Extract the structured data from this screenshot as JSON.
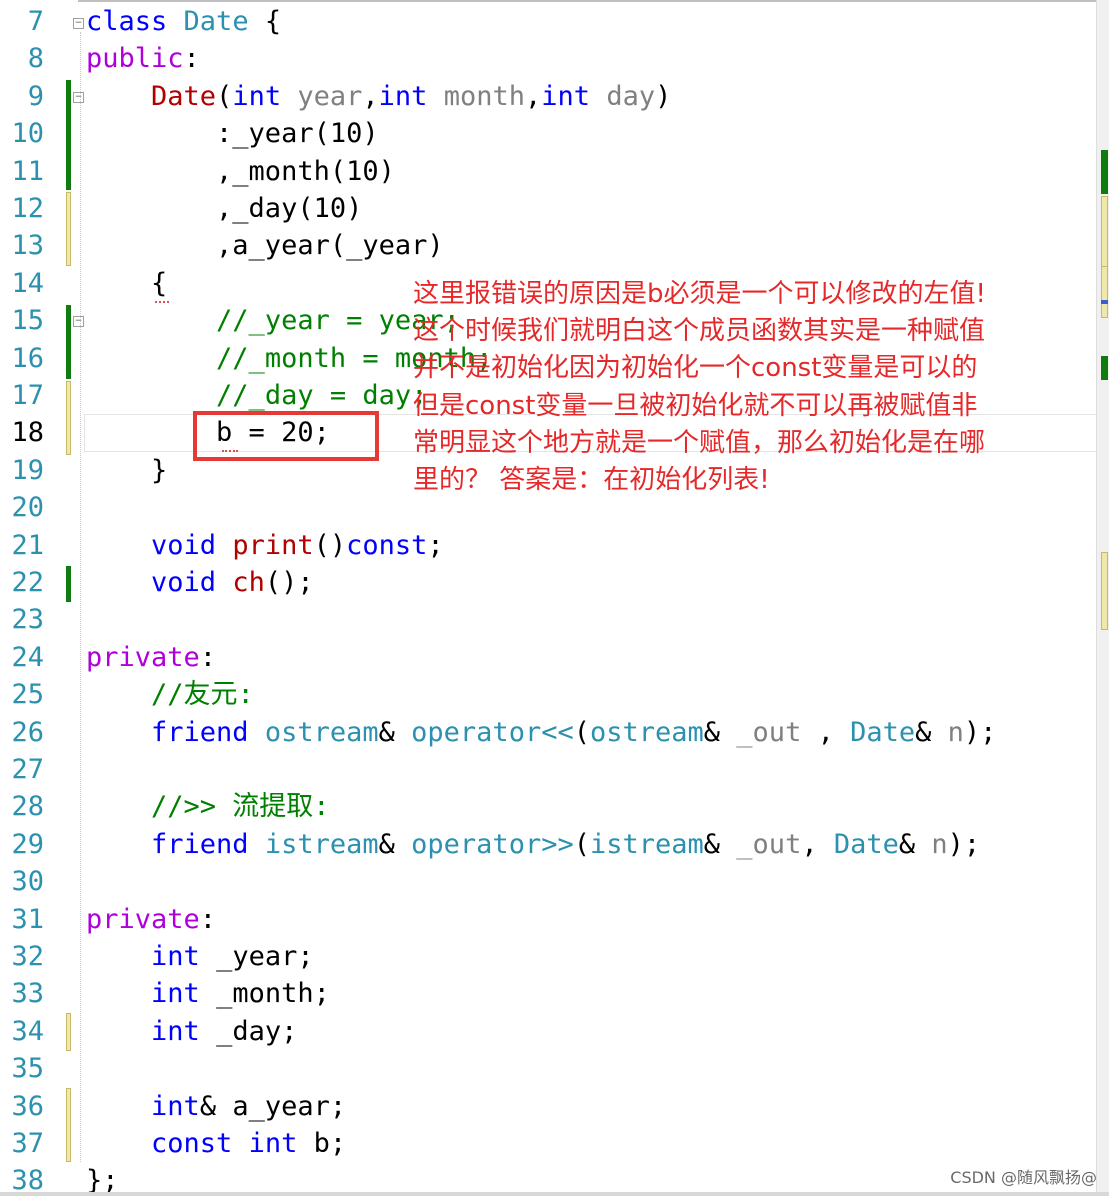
{
  "editor": {
    "lines": [
      {
        "no": "7"
      },
      {
        "no": "8"
      },
      {
        "no": "9"
      },
      {
        "no": "10"
      },
      {
        "no": "11"
      },
      {
        "no": "12"
      },
      {
        "no": "13"
      },
      {
        "no": "14"
      },
      {
        "no": "15"
      },
      {
        "no": "16"
      },
      {
        "no": "17"
      },
      {
        "no": "18"
      },
      {
        "no": "19"
      },
      {
        "no": "20"
      },
      {
        "no": "21"
      },
      {
        "no": "22"
      },
      {
        "no": "23"
      },
      {
        "no": "24"
      },
      {
        "no": "25"
      },
      {
        "no": "26"
      },
      {
        "no": "27"
      },
      {
        "no": "28"
      },
      {
        "no": "29"
      },
      {
        "no": "30"
      },
      {
        "no": "31"
      },
      {
        "no": "32"
      },
      {
        "no": "33"
      },
      {
        "no": "34"
      },
      {
        "no": "35"
      },
      {
        "no": "36"
      },
      {
        "no": "37"
      },
      {
        "no": "38"
      }
    ],
    "tokens": {
      "l7": [
        "class",
        " ",
        "Date",
        " {"
      ],
      "l8": [
        "public",
        ":"
      ],
      "l9": [
        "    ",
        "Date",
        "(",
        "int",
        " ",
        "year",
        ",",
        "int",
        " ",
        "month",
        ",",
        "int",
        " ",
        "day",
        ")"
      ],
      "l10": [
        "        :_year(10)"
      ],
      "l11": [
        "        ,_month(10)"
      ],
      "l12": [
        "        ,_day(10)"
      ],
      "l13": [
        "        ,a_year(_year)"
      ],
      "l14": [
        "    {"
      ],
      "l15": [
        "        ",
        "//_year = year;"
      ],
      "l16": [
        "        ",
        "//_month = month;"
      ],
      "l17": [
        "        ",
        "//_day = day;"
      ],
      "l18": [
        "        b = 20;"
      ],
      "l19": [
        "    }"
      ],
      "l20": [
        ""
      ],
      "l21": [
        "    ",
        "void",
        " ",
        "print",
        "()",
        "const",
        ";"
      ],
      "l22": [
        "    ",
        "void",
        " ",
        "ch",
        "();"
      ],
      "l23": [
        ""
      ],
      "l24": [
        "private",
        ":"
      ],
      "l25": [
        "    ",
        "//友元:"
      ],
      "l26": [
        "    ",
        "friend",
        " ",
        "ostream",
        "& ",
        "operator<<",
        "(",
        "ostream",
        "& ",
        "_out",
        " , ",
        "Date",
        "& ",
        "n",
        ");"
      ],
      "l27": [
        ""
      ],
      "l28": [
        "    ",
        "//>> 流提取:"
      ],
      "l29": [
        "    ",
        "friend",
        " ",
        "istream",
        "& ",
        "operator>>",
        "(",
        "istream",
        "& ",
        "_out",
        ", ",
        "Date",
        "& ",
        "n",
        ");"
      ],
      "l30": [
        ""
      ],
      "l31": [
        "private",
        ":"
      ],
      "l32": [
        "    ",
        "int",
        " _year;"
      ],
      "l33": [
        "    ",
        "int",
        " _month;"
      ],
      "l34": [
        "    ",
        "int",
        " _day;"
      ],
      "l35": [
        ""
      ],
      "l36": [
        "    ",
        "int",
        "& a_year;"
      ],
      "l37": [
        "    ",
        "const",
        " ",
        "int",
        " b;"
      ],
      "l38": [
        "};"
      ]
    }
  },
  "annotation": {
    "lines": [
      "这里报错误的原因是b必须是一个可以修改的左值!",
      "这个时候我们就明白这个成员函数其实是一种赋值",
      "并不是初始化因为初始化一个const变量是可以的",
      "但是const变量一旦被初始化就不可以再被赋值非",
      "常明显这个地方就是一个赋值，那么初始化是在哪",
      "里的？ 答案是：在初始化列表!"
    ]
  },
  "watermark": "CSDN @随风飘扬@",
  "colors": {
    "keyword": "#0000ff",
    "type": "#2b91af",
    "function": "#b00000",
    "comment": "#008000",
    "annotation": "#e5292a",
    "highlight_box": "#e53935",
    "line_number": "#2b91af"
  }
}
